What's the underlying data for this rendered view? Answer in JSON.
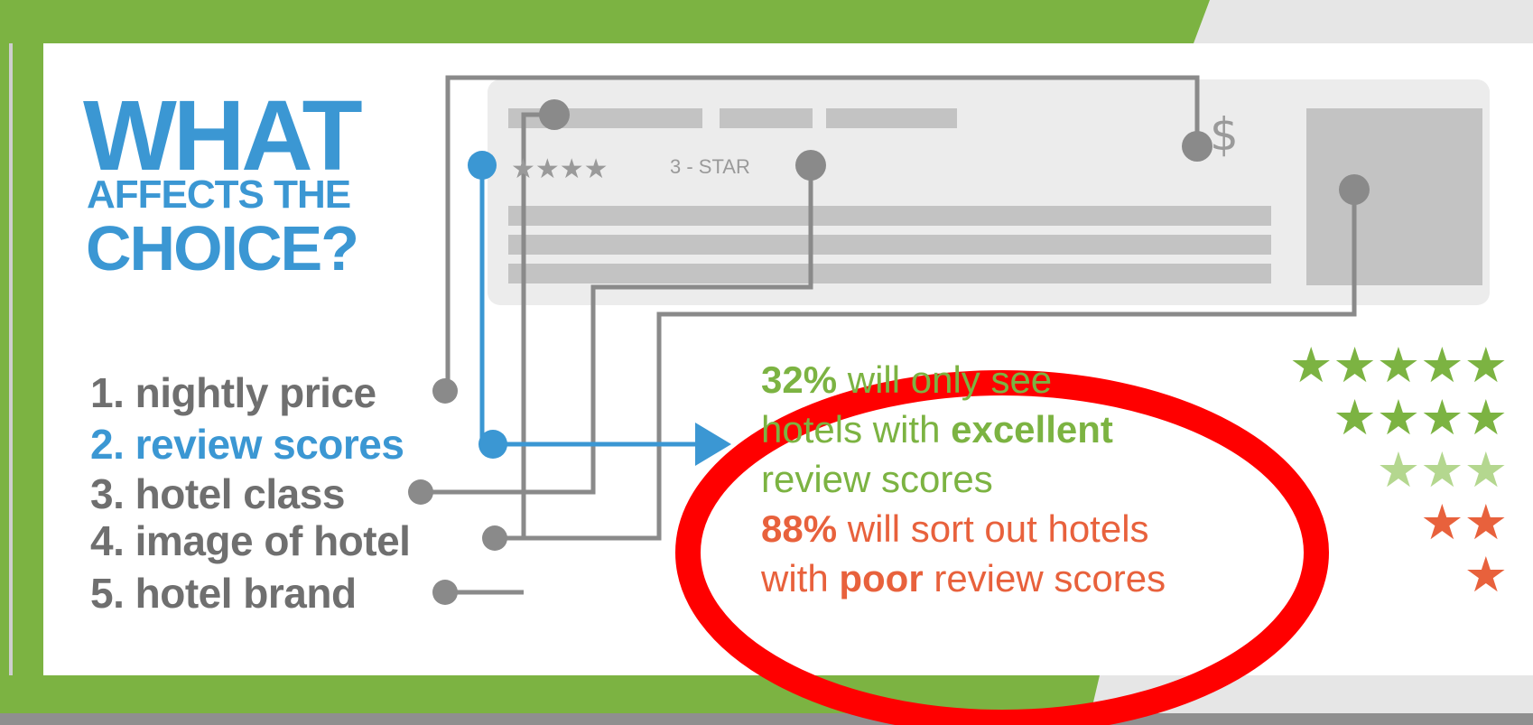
{
  "title": {
    "line1": "WHAT",
    "line2": "AFFECTS THE",
    "line3": "CHOICE?"
  },
  "factors": [
    {
      "label": "1. nightly price"
    },
    {
      "label": "2. review scores"
    },
    {
      "label": "3. hotel class"
    },
    {
      "label": "4. image of hotel"
    },
    {
      "label": "5. hotel brand"
    }
  ],
  "mockup": {
    "rating_stars": "★★★★",
    "class_label": "3 - STAR",
    "price_symbol": "$"
  },
  "stats": {
    "excellent": {
      "pct": "32%",
      "t1": " will only see",
      "t2_pre": "hotels with ",
      "t2_bold": "excellent",
      "t3": "review scores"
    },
    "poor": {
      "pct": "88%",
      "t1": " will sort out hotels",
      "t2_pre": "with ",
      "t2_bold": "poor",
      "t2_post": "  review scores"
    }
  },
  "star_rows": [
    {
      "stars": "★★★★★",
      "color": "#7cb342"
    },
    {
      "stars": "★★★★",
      "color": "#7cb342"
    },
    {
      "stars": "★★★",
      "color": "#b4d78f"
    },
    {
      "stars": "★★",
      "color": "#e8613c"
    },
    {
      "stars": "★",
      "color": "#e8613c"
    }
  ],
  "colors": {
    "green": "#7cb342",
    "blue": "#3b97d3",
    "gray": "#8a8a8a",
    "red_annotation": "#ff0000"
  }
}
